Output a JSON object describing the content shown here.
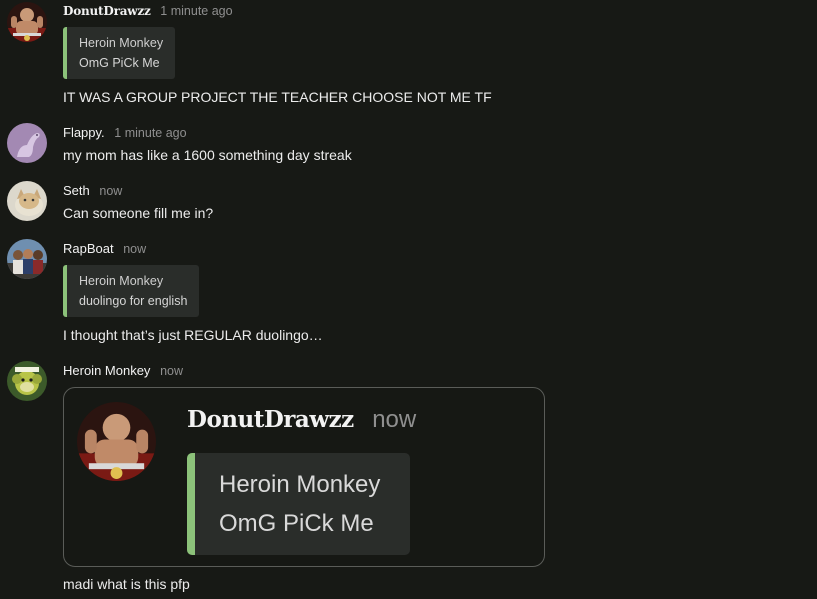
{
  "messages": [
    {
      "author": "DonutDrawzz",
      "time": "1 minute ago",
      "avatar_icon": "wrestler-avatar-icon",
      "reply": {
        "name": "Heroin Monkey",
        "text": "OmG PiCk Me"
      },
      "text": "IT WAS A GROUP PROJECT THE TEACHER CHOOSE NOT ME TF"
    },
    {
      "author": "Flappy.",
      "time": "1 minute ago",
      "avatar_icon": "dinosaur-avatar-icon",
      "text": "my mom has like a 1600 something day streak"
    },
    {
      "author": "Seth",
      "time": "now",
      "avatar_icon": "cat-avatar-icon",
      "text": "Can someone fill me in?"
    },
    {
      "author": "RapBoat",
      "time": "now",
      "avatar_icon": "group-photo-avatar-icon",
      "reply": {
        "name": "Heroin Monkey",
        "text": "duolingo for english"
      },
      "text": "I thought that’s just REGULAR duolingo…"
    },
    {
      "author": "Heroin Monkey",
      "time": "now",
      "avatar_icon": "monkey-avatar-icon",
      "embed": {
        "author": "DonutDrawzz",
        "time": "now",
        "avatar_icon": "wrestler-avatar-icon",
        "reply": {
          "name": "Heroin Monkey",
          "text": "OmG PiCk Me"
        }
      },
      "text": "madi what is this pfp"
    }
  ],
  "colors": {
    "background": "#171915",
    "reply_accent": "#8cc27a",
    "quote_bg": "#2a2d2a",
    "timestamp": "#8f8f8f"
  }
}
